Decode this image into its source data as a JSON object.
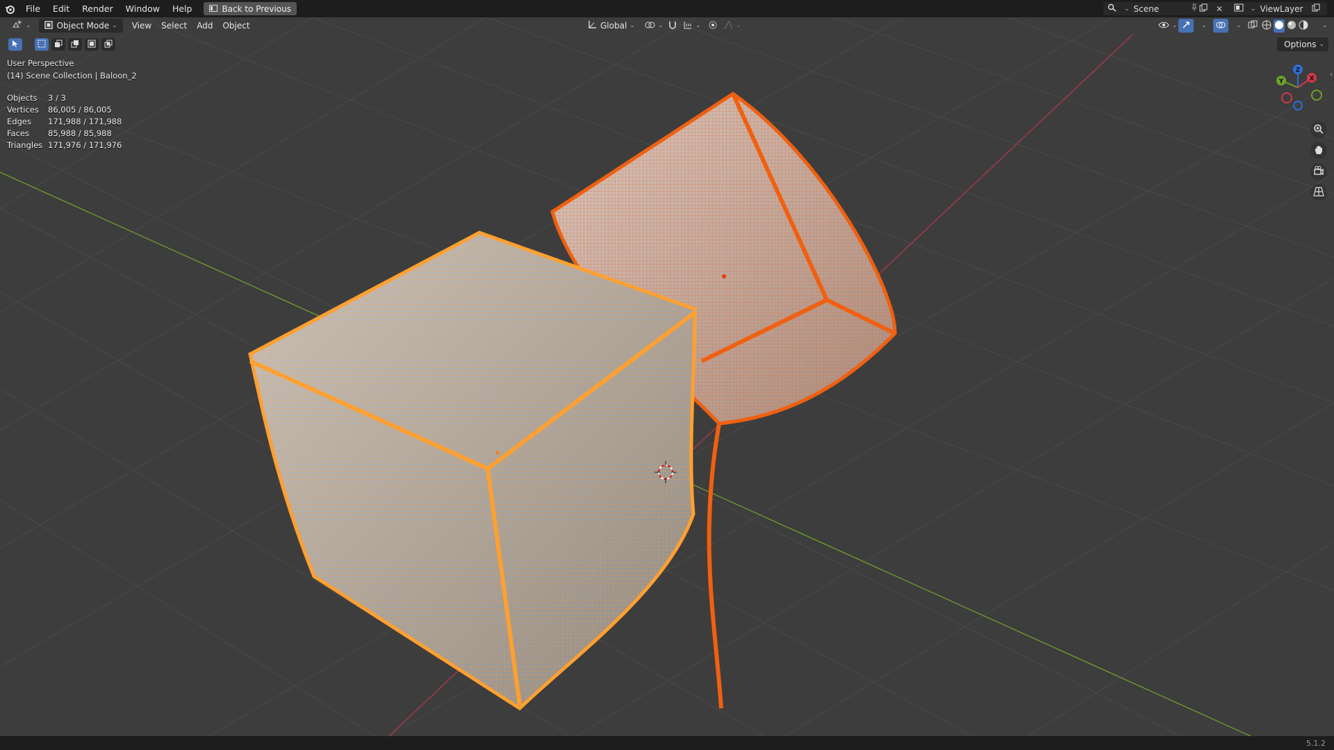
{
  "menu": {
    "file": "File",
    "edit": "Edit",
    "render": "Render",
    "window": "Window",
    "help": "Help",
    "back": "Back to Previous"
  },
  "topright": {
    "scene": "Scene",
    "view_layer": "ViewLayer"
  },
  "header": {
    "mode": "Object Mode",
    "view": "View",
    "select": "Select",
    "add": "Add",
    "object": "Object",
    "orientation": "Global",
    "options": "Options"
  },
  "overlay": {
    "perspective": "User Perspective",
    "collection": "(14) Scene Collection | Baloon_2"
  },
  "stats": [
    {
      "label": "Objects",
      "value": "3 / 3"
    },
    {
      "label": "Vertices",
      "value": "86,005 / 86,005"
    },
    {
      "label": "Edges",
      "value": "171,988 / 171,988"
    },
    {
      "label": "Faces",
      "value": "85,988 / 85,988"
    },
    {
      "label": "Triangles",
      "value": "171,976 / 171,976"
    }
  ],
  "gizmo": {
    "x": "X",
    "y": "Y",
    "z": "Z"
  },
  "version": "5.1.2",
  "colors": {
    "selected_active": "#ffa030",
    "selected": "#f06010",
    "grid": "#4a4a4a",
    "axis_x": "#b3374a",
    "axis_y": "#6ea02a"
  }
}
